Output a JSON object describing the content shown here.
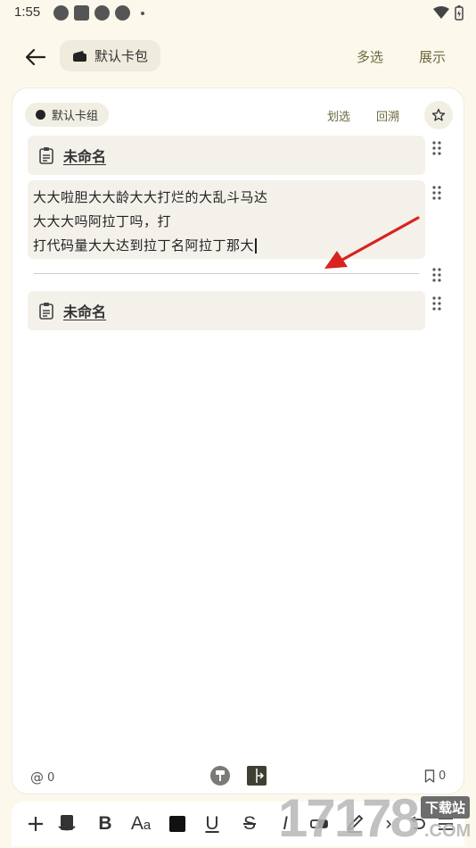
{
  "status": {
    "time": "1:55"
  },
  "header": {
    "wallet_label": "默认卡包",
    "multi_select": "多选",
    "show": "展示"
  },
  "card": {
    "group_label": "默认卡组",
    "swipe_select": "划选",
    "trace_back": "回溯",
    "blocks": [
      {
        "type": "title",
        "text": "未命名"
      },
      {
        "type": "text",
        "lines": [
          "大大啦胆大大龄大大打烂的大乱斗马达",
          "大大大吗阿拉丁吗，打",
          "打代码量大大达到拉丁名阿拉丁那大"
        ]
      },
      {
        "type": "title",
        "text": "未命名"
      }
    ],
    "footer": {
      "mentions": "0",
      "bookmarks": "0"
    }
  },
  "watermark": {
    "digits": "17178",
    "site": "下载站",
    "suffix": ".COM"
  }
}
